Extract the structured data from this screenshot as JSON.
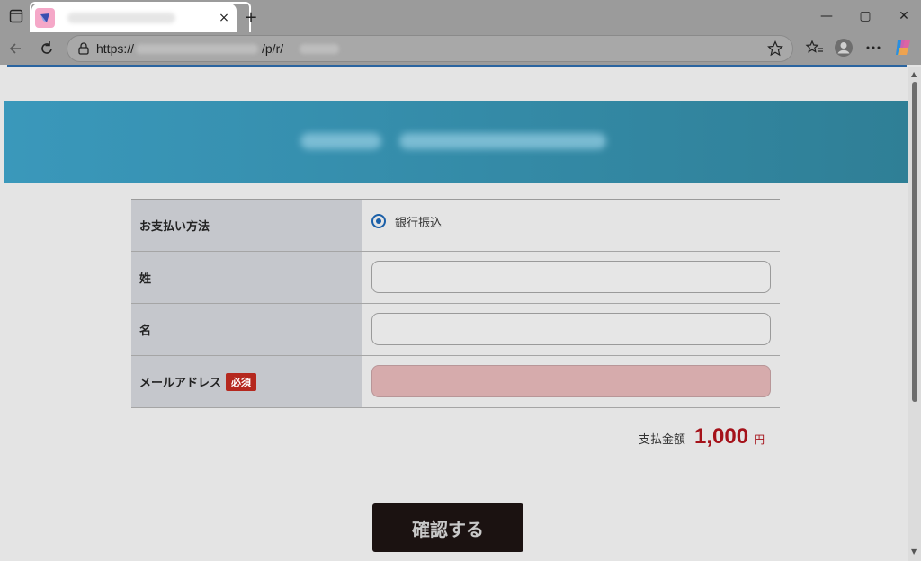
{
  "browser": {
    "tab_close": "×",
    "new_tab": "+",
    "url_prefix": "https://",
    "url_path": "/p/r/",
    "window_controls": [
      "—",
      "▢",
      "✕"
    ],
    "icons": [
      "tabs-icon",
      "favicon-icon",
      "back-icon",
      "refresh-icon",
      "lock-icon",
      "star-icon",
      "favorites-icon",
      "profile-icon",
      "more-icon",
      "copilot-icon"
    ]
  },
  "form": {
    "payment_label": "お支払い方法",
    "payment_option": "銀行振込",
    "last_name_label": "姓",
    "first_name_label": "名",
    "email_label": "メールアドレス",
    "required_badge": "必須",
    "last_name_value": "",
    "first_name_value": "",
    "email_value": ""
  },
  "total": {
    "label": "支払金額",
    "amount": "1,000",
    "unit": "円"
  },
  "confirm_button": "確認する",
  "colors": {
    "banner": "#3a98bb",
    "required": "#b5281e",
    "amount": "#a5121a",
    "button": "#1b1211",
    "invalid_field": "#d6abac"
  }
}
